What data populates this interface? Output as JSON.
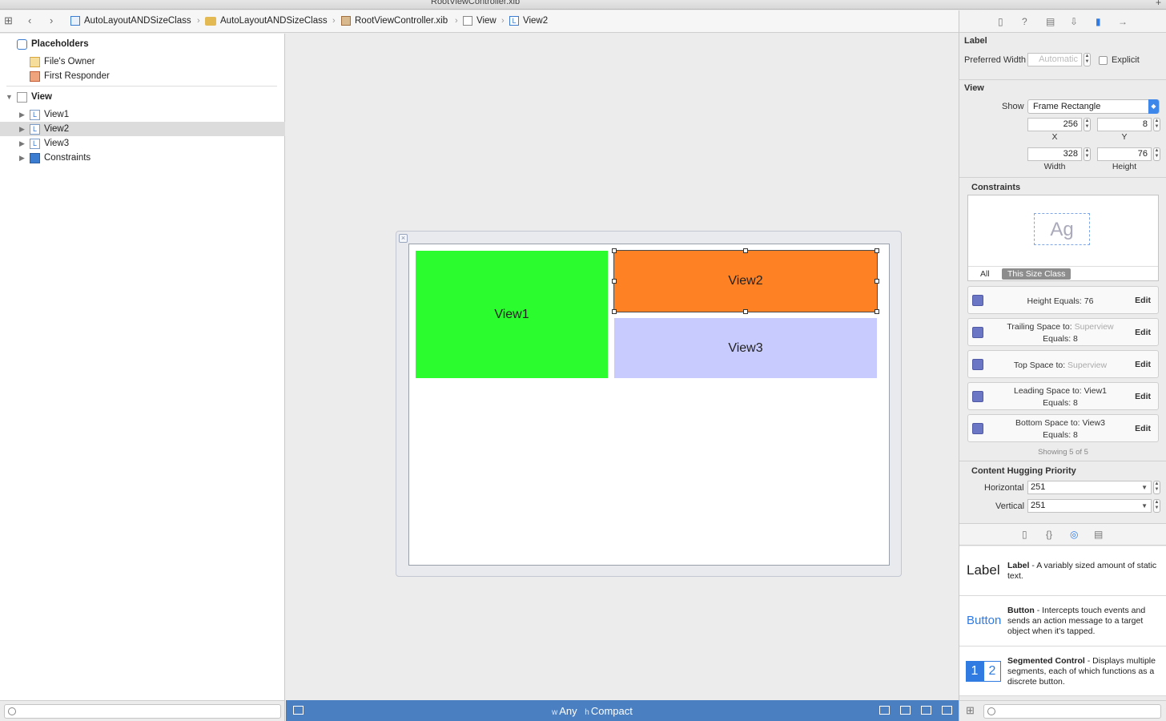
{
  "window": {
    "title": "RootViewController.xib",
    "add_tab": "+"
  },
  "jumpbar": {
    "crumbs": [
      "AutoLayoutANDSizeClass",
      "AutoLayoutANDSizeClass",
      "RootViewController.xib",
      "View",
      "View2"
    ],
    "label_glyph": "L"
  },
  "outline": {
    "placeholders_title": "Placeholders",
    "files_owner": "File's Owner",
    "first_responder": "First Responder",
    "root": "View",
    "children": [
      "View1",
      "View2",
      "View3",
      "Constraints"
    ],
    "selected": "View2",
    "label_glyph": "L"
  },
  "canvas": {
    "view1_label": "View1",
    "view2_label": "View2",
    "view3_label": "View3",
    "colors": {
      "view1": "#2afc2e",
      "view2": "#fe8123",
      "view3": "#c8cbfd"
    }
  },
  "size_class": {
    "w_prefix": "w",
    "w_value": "Any",
    "h_prefix": "h",
    "h_value": "Compact"
  },
  "inspector": {
    "label_section": "Label",
    "preferred_width_label": "Preferred Width",
    "preferred_width_placeholder": "Automatic",
    "explicit_label": "Explicit",
    "view_section": "View",
    "show_label": "Show",
    "show_value": "Frame Rectangle",
    "x": "256",
    "y": "8",
    "width": "328",
    "height": "76",
    "x_label": "X",
    "y_label": "Y",
    "width_label": "Width",
    "height_label": "Height",
    "constraints_section": "Constraints",
    "preview_text": "Ag",
    "tab_all": "All",
    "tab_size_class": "This Size Class",
    "constraints": [
      {
        "l1": "Height Equals:",
        "l1b": "76",
        "l1gray": "",
        "l2": "",
        "edit": "Edit"
      },
      {
        "l1": "Trailing Space to:",
        "l1b": "",
        "l1gray": "Superview",
        "l2": "Equals:  8",
        "edit": "Edit"
      },
      {
        "l1": "Top Space to:",
        "l1b": "",
        "l1gray": "Superview",
        "l2": "",
        "edit": "Edit"
      },
      {
        "l1": "Leading Space to:",
        "l1b": "View1",
        "l1gray": "",
        "l2": "Equals:  8",
        "edit": "Edit"
      },
      {
        "l1": "Bottom Space to:",
        "l1b": "View3",
        "l1gray": "",
        "l2": "Equals:  8",
        "edit": "Edit"
      }
    ],
    "showing": "Showing 5 of 5",
    "hugging_section": "Content Hugging Priority",
    "horizontal_label": "Horizontal",
    "horizontal_value": "251",
    "vertical_label": "Vertical",
    "vertical_value": "251"
  },
  "library": {
    "label_item": {
      "big": "Label",
      "name": "Label",
      "desc": " - A variably sized amount of static text."
    },
    "button_item": {
      "big": "Button",
      "name": "Button",
      "desc": " - Intercepts touch events and sends an action message to a target object when it's tapped."
    },
    "segmented_item": {
      "seg1": "1",
      "seg2": "2",
      "name": "Segmented Control",
      "desc": " - Displays multiple segments, each of which functions as a discrete button."
    }
  }
}
